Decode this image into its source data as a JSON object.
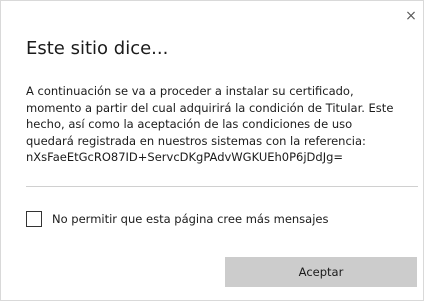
{
  "dialog": {
    "close_glyph": "×",
    "title": "Este sitio dice...",
    "message_lines": [
      "A continuación se va a proceder a instalar su certificado,",
      "momento a partir del cual adquirirá la condición de Titular. Este",
      "hecho, así como la aceptación de las condiciones de uso",
      "quedará registrada en nuestros sistemas con la referencia:",
      "nXsFaeEtGcRO87ID+ServcDKgPAdvWGKUEh0P6jDdJg="
    ],
    "checkbox_label": "No permitir que esta página cree más mensajes",
    "checkbox_checked": false,
    "accept_label": "Aceptar"
  },
  "colors": {
    "background": "#ffffff",
    "text": "#1b1b1b",
    "button_bg": "#cccccc",
    "divider": "#d0d0d0"
  },
  "icons": {
    "close": "close-icon"
  }
}
